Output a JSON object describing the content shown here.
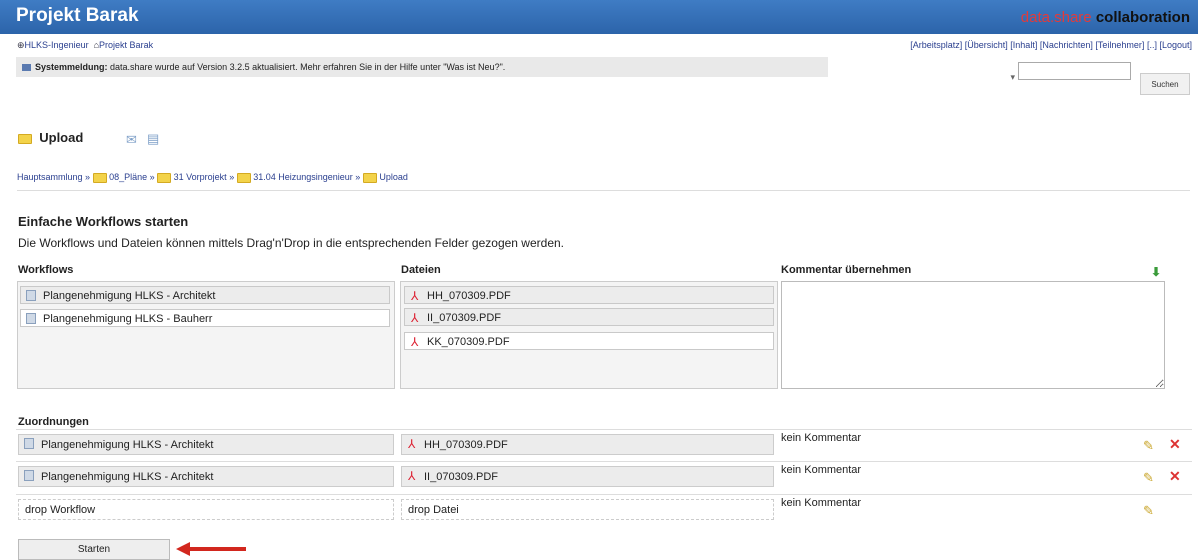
{
  "header": {
    "title": "Projekt Barak",
    "brand_part1": "data.share",
    "brand_part2": " collaboration"
  },
  "nav": {
    "crumb1": "HLKS-Ingenieur",
    "crumb2": "Projekt Barak",
    "links": [
      "[Arbeitsplatz]",
      "[Übersicht]",
      "[Inhalt]",
      "[Nachrichten]",
      "[Teilnehmer]",
      "[..]",
      "[Logout]"
    ]
  },
  "system_message": {
    "label": "Systemmeldung:",
    "text": " data.share wurde auf Version 3.2.5 aktualisiert. Mehr erfahren Sie in der Hilfe unter \"Was ist Neu?\"."
  },
  "search": {
    "button_label": "Suchen",
    "placeholder": ""
  },
  "page": {
    "title": "Upload",
    "breadcrumb": [
      "Hauptsammlung",
      "08_Pläne",
      "31 Vorprojekt",
      "31.04 Heizungsingenieur",
      "Upload"
    ]
  },
  "workflow_section": {
    "title": "Einfache Workflows starten",
    "description": "Die Workflows und Dateien können mittels Drag'n'Drop in die entsprechenden Felder gezogen werden.",
    "col_workflows": "Workflows",
    "col_files": "Dateien",
    "col_comment": "Kommentar übernehmen",
    "workflows": [
      "Plangenehmigung HLKS - Architekt",
      "Plangenehmigung HLKS - Bauherr"
    ],
    "files": [
      "HH_070309.PDF",
      "II_070309.PDF",
      "KK_070309.PDF"
    ]
  },
  "assignments": {
    "title": "Zuordnungen",
    "rows": [
      {
        "workflow": "Plangenehmigung HLKS - Architekt",
        "file": "HH_070309.PDF",
        "comment": "kein Kommentar"
      },
      {
        "workflow": "Plangenehmigung HLKS - Architekt",
        "file": "II_070309.PDF",
        "comment": "kein Kommentar"
      },
      {
        "workflow": "drop Workflow",
        "file": "drop Datei",
        "comment": "kein Kommentar"
      }
    ]
  },
  "start_button": "Starten"
}
